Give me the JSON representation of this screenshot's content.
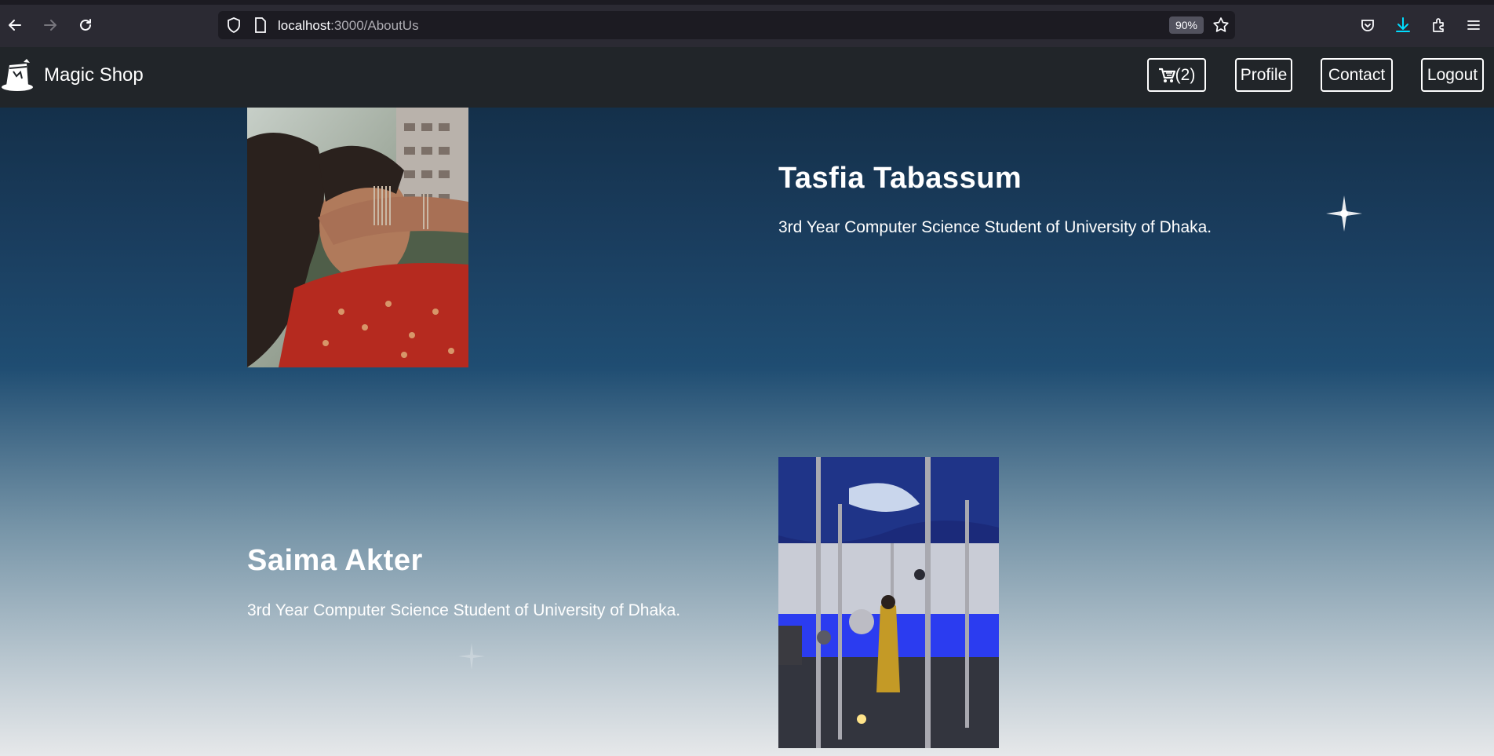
{
  "browser": {
    "url_host": "localhost",
    "url_path": ":3000/AboutUs",
    "zoom": "90%"
  },
  "navbar": {
    "brand": "Magic Shop",
    "cart_label": "(2)",
    "profile_label": "Profile",
    "contact_label": "Contact",
    "logout_label": "Logout"
  },
  "members": [
    {
      "name": "Tasfia Tabassum",
      "description": "3rd Year Computer Science Student of University of Dhaka."
    },
    {
      "name": "Saima Akter",
      "description": "3rd Year Computer Science Student of University of Dhaka."
    }
  ],
  "colors": {
    "navbar_bg": "#212529",
    "chrome_bg": "#2b2a33",
    "download_accent": "#00ddff"
  }
}
